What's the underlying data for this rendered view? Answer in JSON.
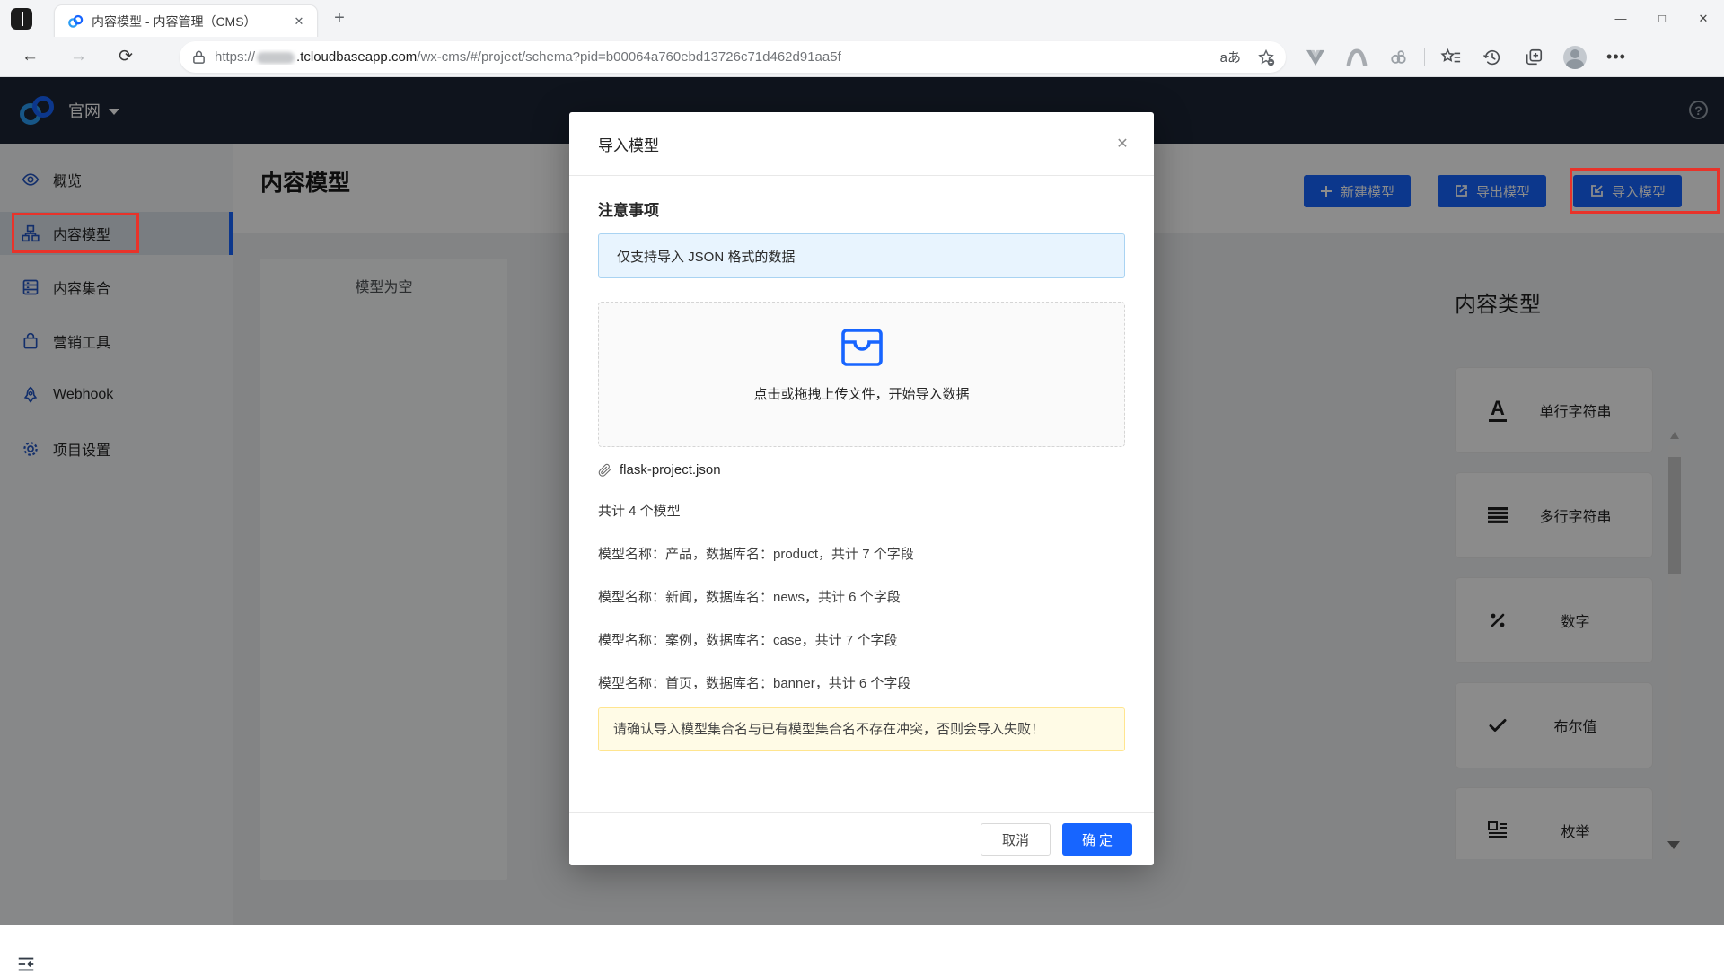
{
  "browser": {
    "tab_title": "内容模型 - 内容管理（CMS）",
    "tab_close": "✕",
    "new_tab": "+",
    "window_controls": {
      "minimize": "—",
      "maximize": "□",
      "close": "✕"
    },
    "nav": {
      "back": "←",
      "forward": "→",
      "refresh": "⟳"
    },
    "url": {
      "protocol": "https://",
      "domain": ".tcloudbaseapp.com",
      "path": "/wx-cms/#/project/schema?pid=b00064a760ebd13726c71d462d91aa5f"
    },
    "translate_label": "aあ",
    "more_label": "•••"
  },
  "app_header": {
    "site_name": "官网",
    "help_label": "?"
  },
  "sidebar": {
    "items": [
      {
        "label": "概览"
      },
      {
        "label": "内容模型"
      },
      {
        "label": "内容集合"
      },
      {
        "label": "营销工具"
      },
      {
        "label": "Webhook"
      },
      {
        "label": "项目设置"
      }
    ]
  },
  "page": {
    "title": "内容模型",
    "empty_state": "模型为空",
    "actions": [
      {
        "label": "新建模型",
        "icon": "plus"
      },
      {
        "label": "导出模型",
        "icon": "export"
      },
      {
        "label": "导入模型",
        "icon": "import"
      }
    ]
  },
  "content_types": {
    "title": "内容类型",
    "items": [
      {
        "label": "单行字符串",
        "icon": "single-line-text"
      },
      {
        "label": "多行字符串",
        "icon": "multi-line-text"
      },
      {
        "label": "数字",
        "icon": "number"
      },
      {
        "label": "布尔值",
        "icon": "boolean"
      },
      {
        "label": "枚举",
        "icon": "enum"
      }
    ]
  },
  "modal": {
    "title": "导入模型",
    "close": "✕",
    "section_heading": "注意事项",
    "info_text": "仅支持导入 JSON 格式的数据",
    "upload_text": "点击或拖拽上传文件，开始导入数据",
    "file_name": "flask-project.json",
    "summary": "共计 4 个模型",
    "models": [
      "模型名称：产品，数据库名：product，共计 7 个字段",
      "模型名称：新闻，数据库名：news，共计 6 个字段",
      "模型名称：案例，数据库名：case，共计 7 个字段",
      "模型名称：首页，数据库名：banner，共计 6 个字段"
    ],
    "warning_text": "请确认导入模型集合名与已有模型集合名不存在冲突，否则会导入失败！",
    "cancel_label": "取消",
    "confirm_label": "确定"
  },
  "colors": {
    "primary": "#1765ff",
    "annotation_red": "#e8332a",
    "info_bg": "#e8f4fe",
    "info_border": "#a9d3f2",
    "warning_bg": "#fffbe6",
    "warning_border": "#ffe58f",
    "app_header_bg": "#1d2636"
  }
}
